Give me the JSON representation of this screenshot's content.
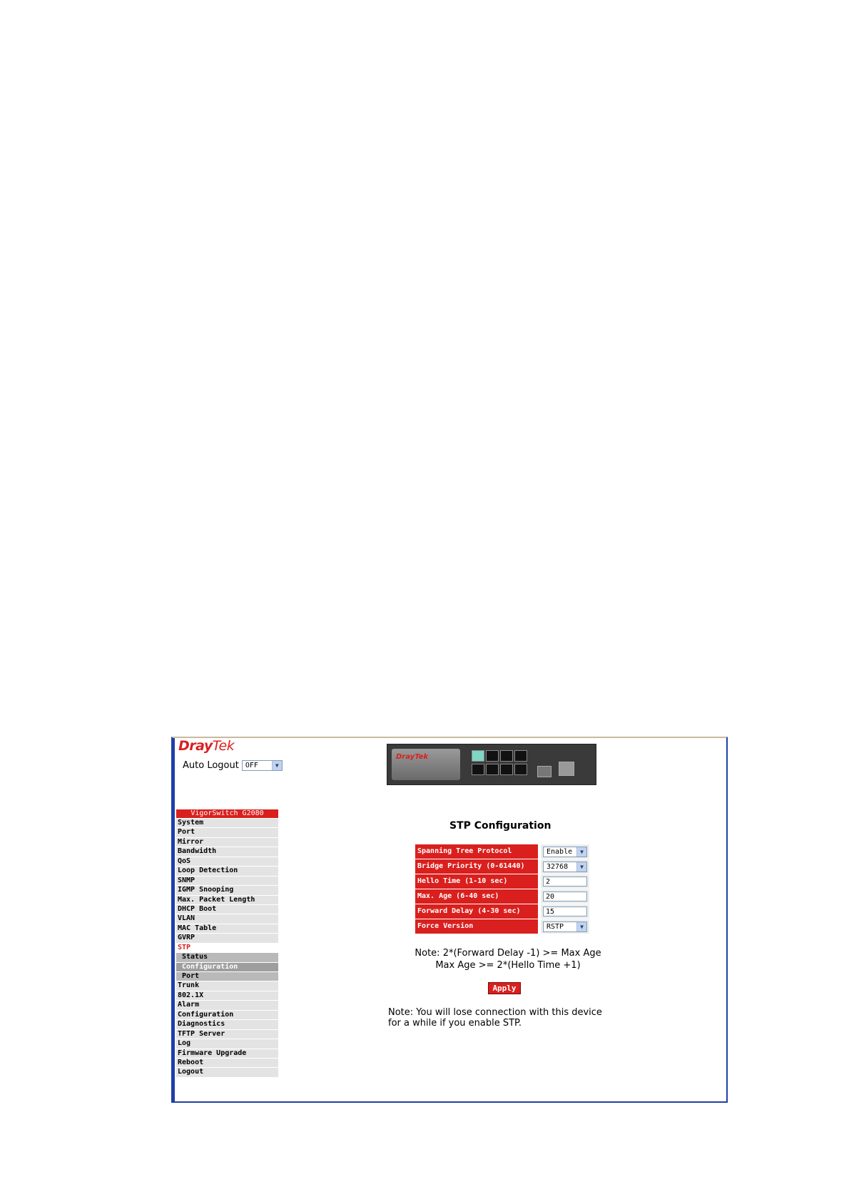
{
  "logo": {
    "part1": "Dray",
    "part2": "Tek"
  },
  "auto_logout": {
    "label": "Auto Logout",
    "value": "OFF"
  },
  "nav": {
    "title": "VigorSwitch G2080",
    "items": [
      "System",
      "Port",
      "Mirror",
      "Bandwidth",
      "QoS",
      "Loop Detection",
      "SNMP",
      "IGMP Snooping",
      "Max. Packet Length",
      "DHCP Boot",
      "VLAN",
      "MAC Table",
      "GVRP",
      "STP"
    ],
    "sub_items": [
      "Status",
      "Configuration",
      "Port"
    ],
    "items_after": [
      "Trunk",
      "802.1X",
      "Alarm",
      "Configuration",
      "Diagnostics",
      "TFTP Server",
      "Log",
      "Firmware Upgrade",
      "Reboot",
      "Logout"
    ]
  },
  "page": {
    "title": "STP Configuration",
    "fields": [
      {
        "label": "Spanning Tree Protocol",
        "value": "Enable"
      },
      {
        "label": "Bridge Priority (0-61440)",
        "value": "32768"
      },
      {
        "label": "Hello Time (1-10 sec)",
        "value": "2"
      },
      {
        "label": "Max. Age (6-40 sec)",
        "value": "20"
      },
      {
        "label": "Forward Delay (4-30 sec)",
        "value": "15"
      },
      {
        "label": "Force Version",
        "value": "RSTP"
      }
    ],
    "note_line1": "Note: 2*(Forward Delay -1) >= Max Age",
    "note_line2": "Max Age >= 2*(Hello Time +1)",
    "apply_label": "Apply",
    "warn_line1": "Note: You will lose connection with this device",
    "warn_line2": "for a while if you enable STP."
  },
  "device_logo": "DrayTek"
}
